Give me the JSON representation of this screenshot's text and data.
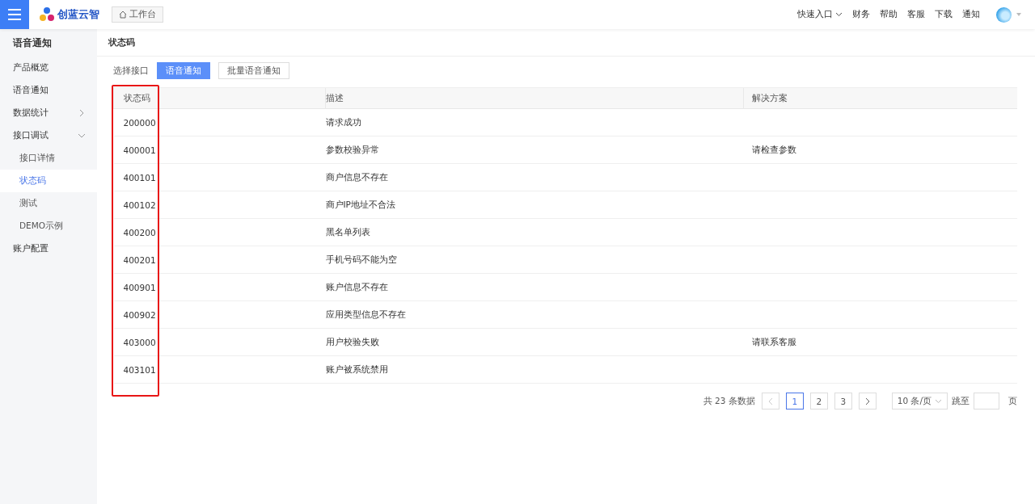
{
  "header": {
    "brand": "创蓝云智",
    "home_tab": "工作台",
    "links": [
      {
        "label": "快速入口",
        "dropdown": true
      },
      {
        "label": "财务",
        "dropdown": false
      },
      {
        "label": "帮助",
        "dropdown": false
      },
      {
        "label": "客服",
        "dropdown": false
      },
      {
        "label": "下载",
        "dropdown": false
      },
      {
        "label": "通知",
        "dropdown": false
      }
    ]
  },
  "sidebar": {
    "title": "语音通知",
    "items": [
      {
        "label": "产品概览",
        "selected": false
      },
      {
        "label": "语音通知",
        "selected": false
      },
      {
        "label": "数据统计",
        "selected": false,
        "expanded": false
      },
      {
        "label": "接口调试",
        "selected": false,
        "expanded": true,
        "children": [
          {
            "label": "接口详情",
            "selected": false
          },
          {
            "label": "状态码",
            "selected": true
          },
          {
            "label": "测试",
            "selected": false
          },
          {
            "label": "DEMO示例",
            "selected": false
          }
        ]
      },
      {
        "label": "账户配置",
        "selected": false
      }
    ]
  },
  "page_title": "状态码",
  "interface_picker": {
    "label": "选择接口",
    "options": [
      {
        "label": "语音通知",
        "selected": true
      },
      {
        "label": "批量语音通知",
        "selected": false
      }
    ]
  },
  "table": {
    "columns": [
      "状态码",
      "描述",
      "解决方案"
    ],
    "highlight_first_column": true,
    "rows": [
      {
        "code": "200000",
        "description": "请求成功"
      },
      {
        "code": "400001",
        "description": "参数校验异常",
        "solution": "请检查参数"
      },
      {
        "code": "400101",
        "description": "商户信息不存在"
      },
      {
        "code": "400102",
        "description": "商户IP地址不合法"
      },
      {
        "code": "400200",
        "description": "黑名单列表"
      },
      {
        "code": "400201",
        "description": "手机号码不能为空"
      },
      {
        "code": "400901",
        "description": "账户信息不存在"
      },
      {
        "code": "400902",
        "description": "应用类型信息不存在"
      },
      {
        "code": "403000",
        "description": "用户校验失败",
        "solution": "请联系客服"
      },
      {
        "code": "403101",
        "description": "账户被系统禁用"
      }
    ]
  },
  "pagination": {
    "total": "共 23 条数据",
    "pages": [
      {
        "label": "1",
        "selected": true
      },
      {
        "label": "2",
        "selected": false
      },
      {
        "label": "3",
        "selected": false
      }
    ],
    "page_size": "10 条/页",
    "jump_label": "跳至",
    "jump_suffix": "页"
  }
}
